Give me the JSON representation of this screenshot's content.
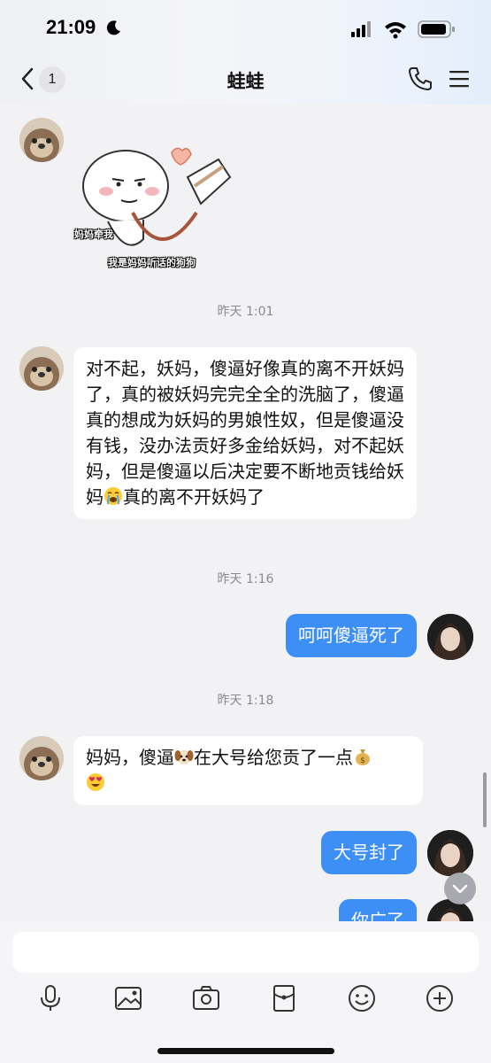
{
  "status_bar": {
    "time": "21:09"
  },
  "header": {
    "unread_count": "1",
    "title": "蛙蛙"
  },
  "sticker": {
    "caption_left": "妈妈牵我",
    "caption_bottom": "我是妈妈听话的狗狗"
  },
  "messages": [
    {
      "type": "time",
      "text": "昨天 1:01"
    },
    {
      "type": "incoming",
      "text": "对不起，妖妈，傻逼好像真的离不开妖妈了，真的被妖妈完完全全的洗脑了，傻逼真的想成为妖妈的男娘性奴，但是傻逼没有钱，没办法贡好多金给妖妈，对不起妖妈，但是傻逼以后决定要不断地贡钱给妖妈",
      "after_emoji": "真的离不开妖妈了"
    },
    {
      "type": "time",
      "text": "昨天 1:16"
    },
    {
      "type": "outgoing",
      "text": "呵呵傻逼死了"
    },
    {
      "type": "time",
      "text": "昨天 1:18"
    },
    {
      "type": "incoming",
      "part1": "妈妈，傻逼",
      "part2": "在大号给您贡了一点"
    },
    {
      "type": "outgoing",
      "text": "大号封了"
    },
    {
      "type": "outgoing",
      "text": "你广了"
    }
  ],
  "input": {
    "value": ""
  },
  "toolbar": [
    "mic-icon",
    "image-icon",
    "camera-icon",
    "red-packet-icon",
    "emoji-icon",
    "plus-icon"
  ]
}
